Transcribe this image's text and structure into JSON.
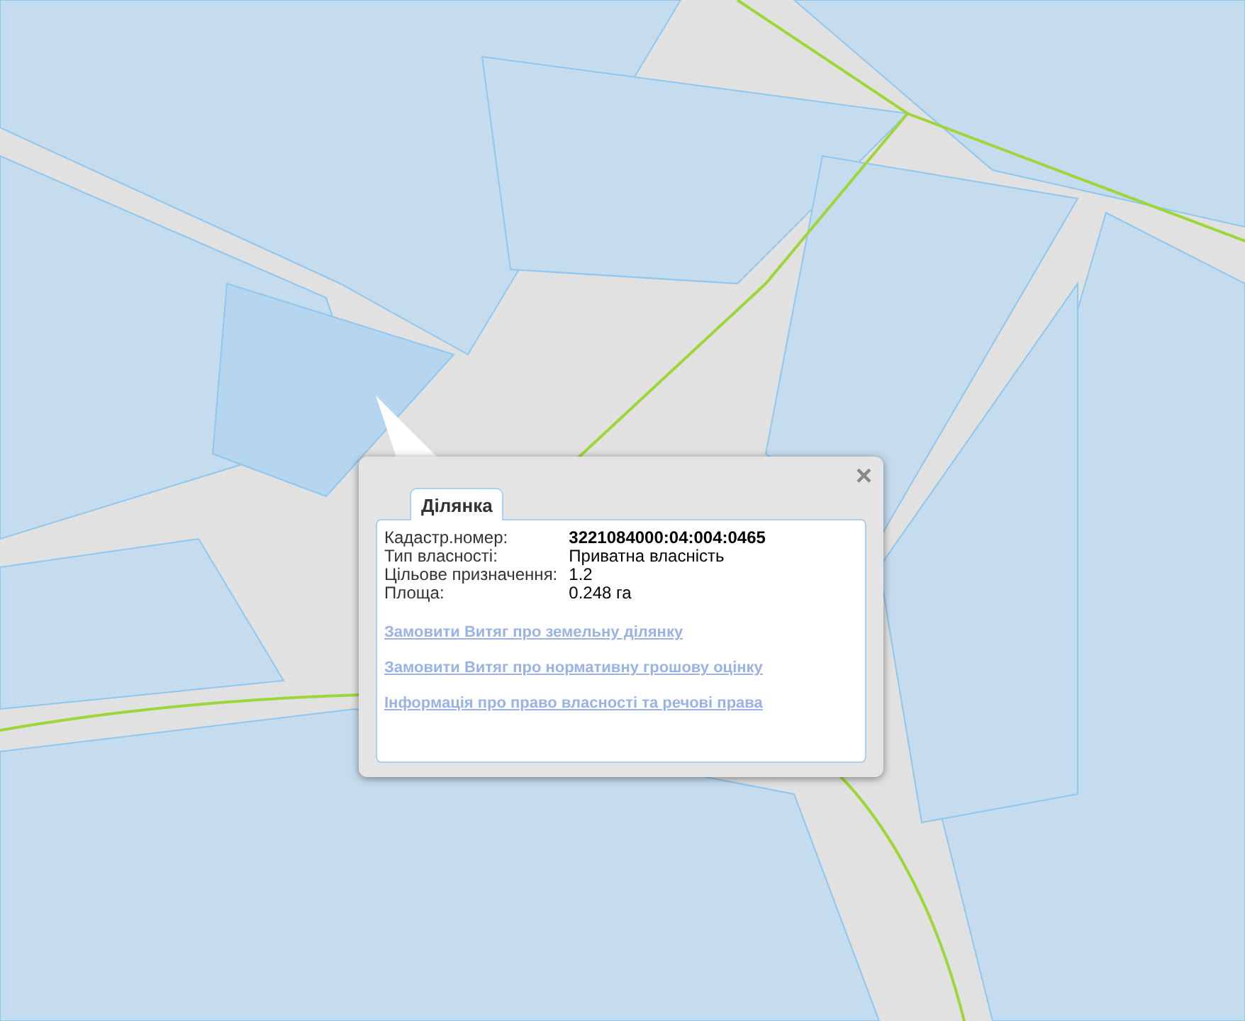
{
  "popup": {
    "close": "×",
    "tabs": [
      {
        "label": "Ділянка",
        "selected": true
      }
    ],
    "fields": [
      {
        "label": "Кадастр.номер:",
        "value": "3221084000:04:004:0465",
        "bold": true
      },
      {
        "label": "Тип власності:",
        "value": "Приватна власність",
        "bold": false
      },
      {
        "label": "Цільове призначення:",
        "value": "1.2",
        "bold": false
      },
      {
        "label": "Площа:",
        "value": "0.248 га",
        "bold": false
      }
    ],
    "links": [
      "Замовити Витяг про земельну ділянку",
      "Замовити Витяг про нормативну грошову оцінку",
      "Інформація про право власності та речові права"
    ]
  }
}
